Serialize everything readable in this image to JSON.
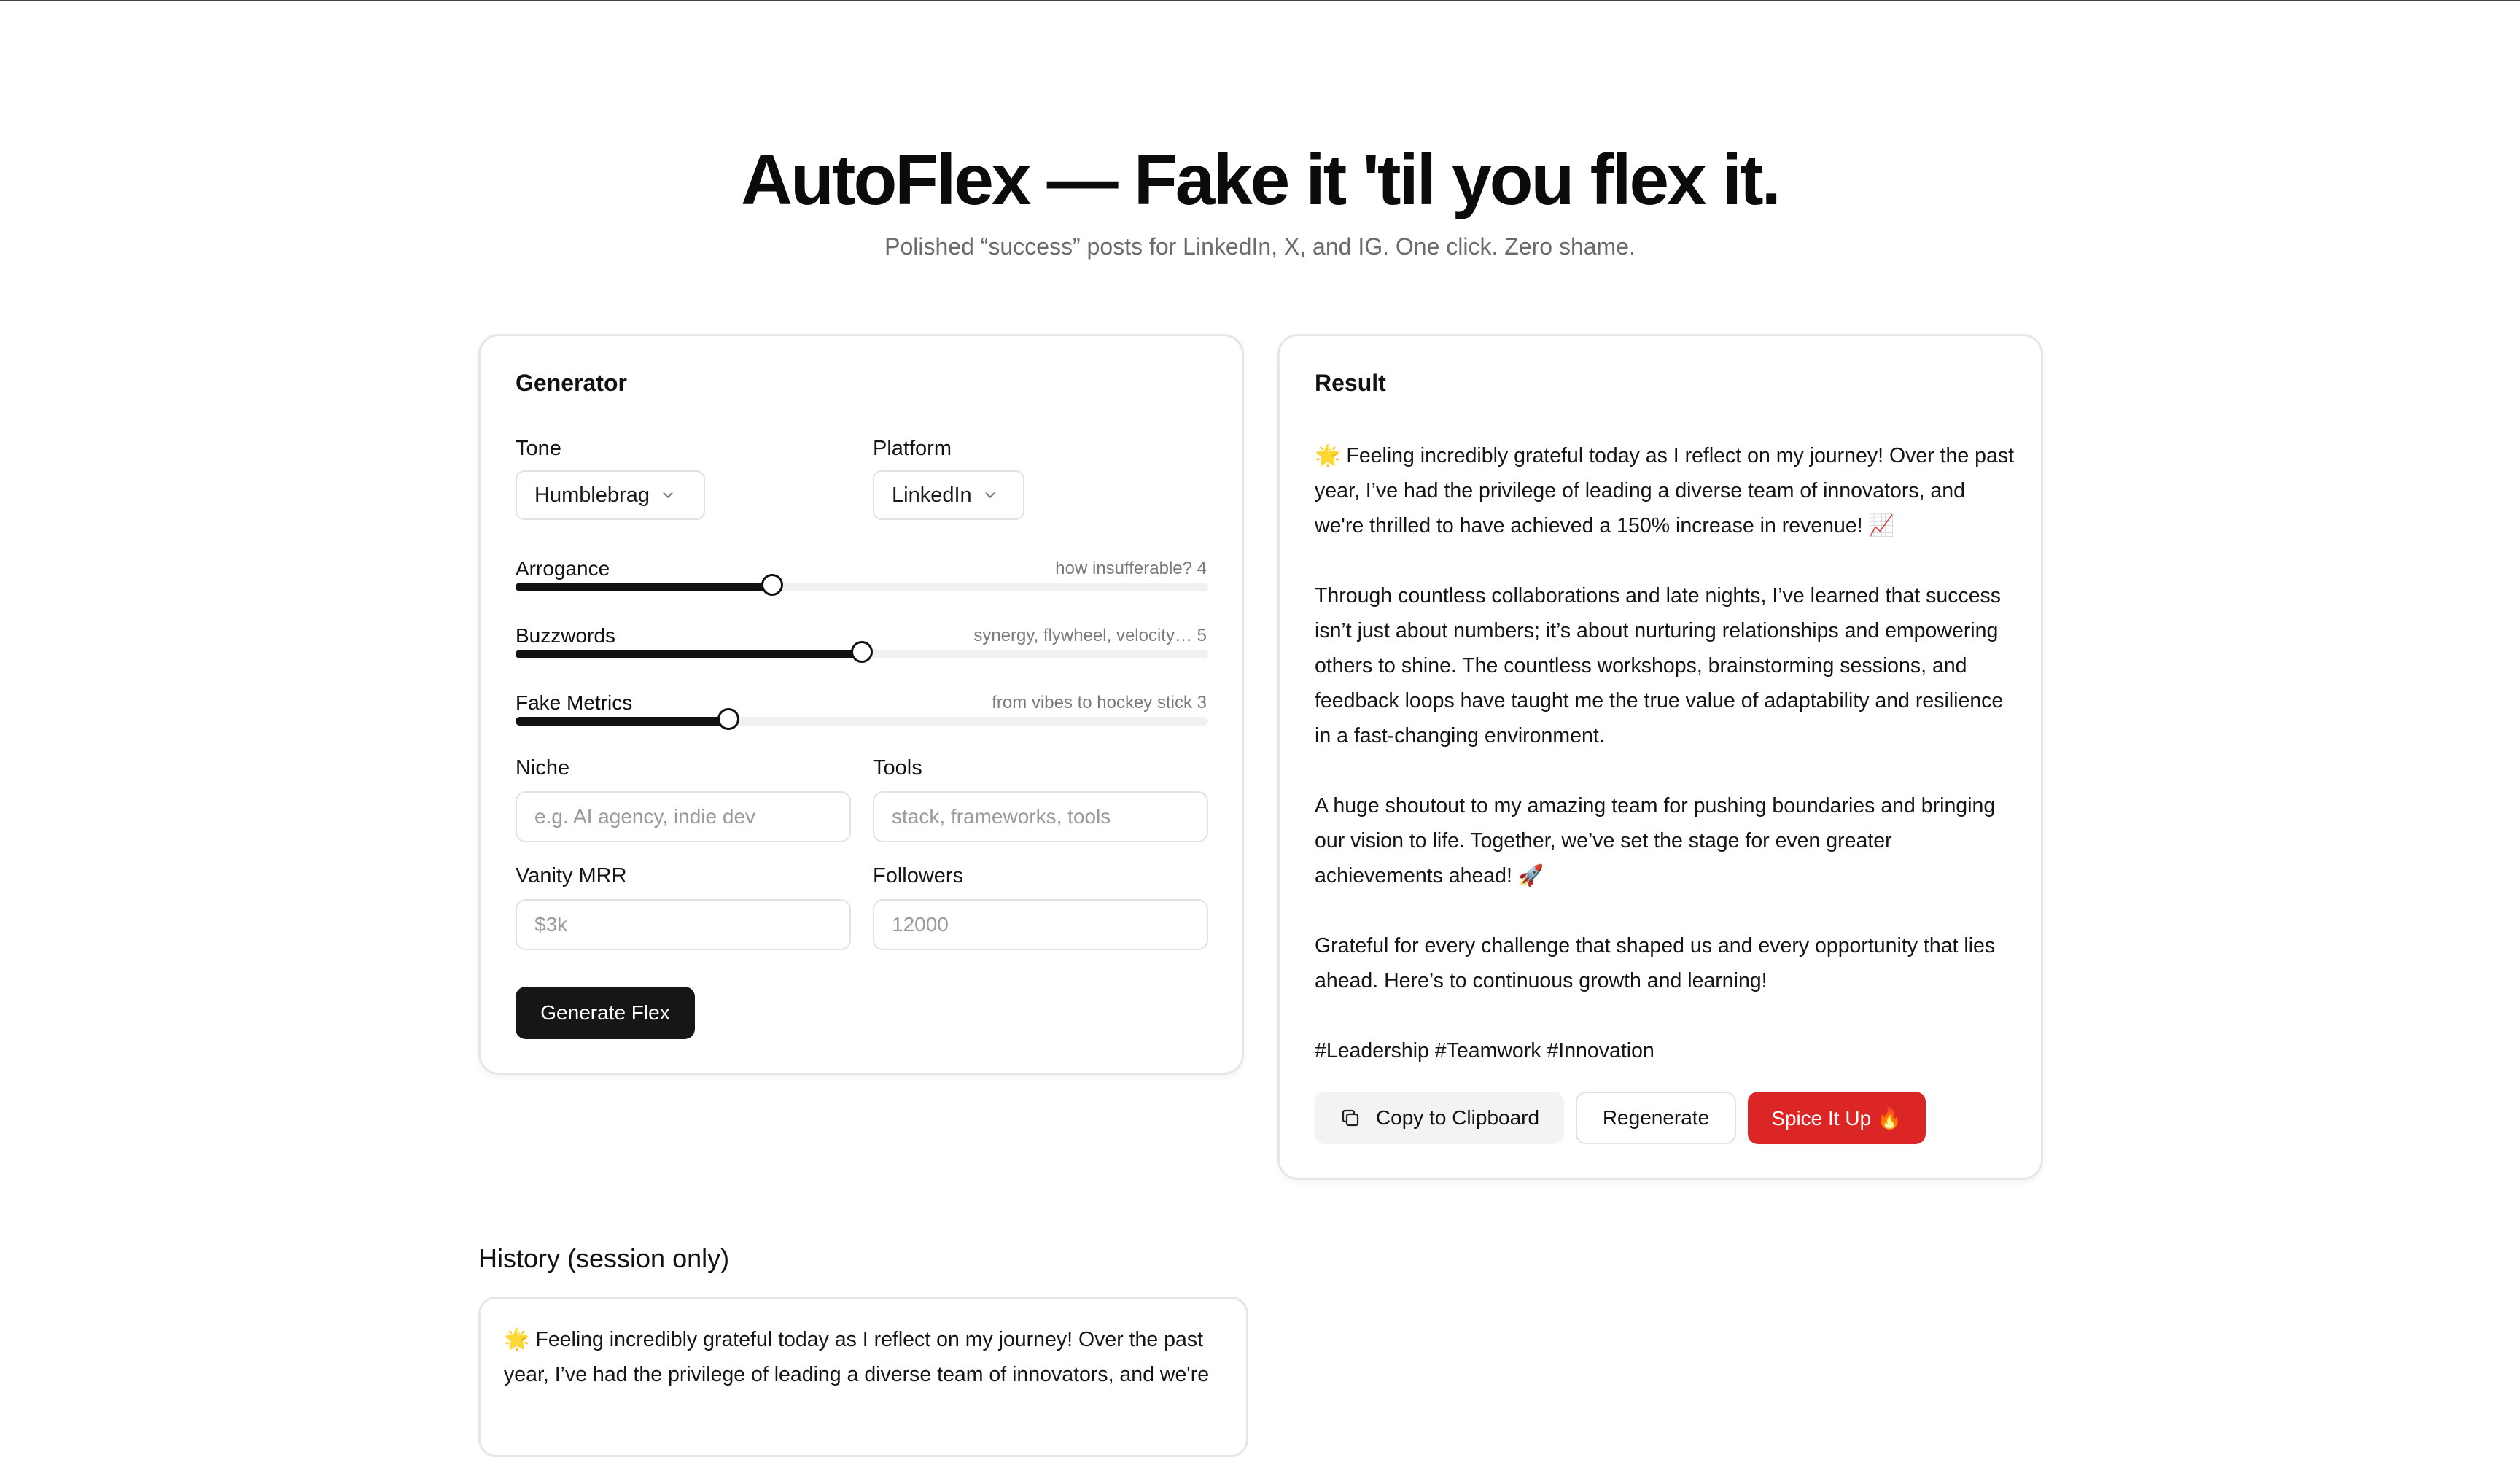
{
  "header": {
    "title": "AutoFlex — Fake it 'til you flex it.",
    "subtitle": "Polished “success” posts for LinkedIn, X, and IG. One click. Zero shame."
  },
  "generator": {
    "title": "Generator",
    "tone": {
      "label": "Tone",
      "value": "Humblebrag"
    },
    "platform": {
      "label": "Platform",
      "value": "LinkedIn"
    },
    "sliders": [
      {
        "label": "Arrogance",
        "hint": "how insufferable? 4",
        "value": 4,
        "fraction": 0.37
      },
      {
        "label": "Buzzwords",
        "hint": "synergy, flywheel, velocity… 5",
        "value": 5,
        "fraction": 0.5
      },
      {
        "label": "Fake Metrics",
        "hint": "from vibes to hockey stick 3",
        "value": 3,
        "fraction": 0.307
      }
    ],
    "niche": {
      "label": "Niche",
      "placeholder": "e.g. AI agency, indie dev",
      "value": ""
    },
    "tools": {
      "label": "Tools",
      "placeholder": "stack, frameworks, tools",
      "value": ""
    },
    "vanity_mrr": {
      "label": "Vanity MRR",
      "placeholder": "$3k",
      "value": ""
    },
    "followers": {
      "label": "Followers",
      "placeholder": "12000",
      "value": ""
    },
    "generate_label": "Generate Flex"
  },
  "result": {
    "title": "Result",
    "paragraphs": [
      "🌟 Feeling incredibly grateful today as I reflect on my journey! Over the past year, I’ve had the privilege of leading a diverse team of innovators, and we're thrilled to have achieved a 150% increase in revenue! 📈",
      "Through countless collaborations and late nights, I’ve learned that success isn’t just about numbers; it’s about nurturing relationships and empowering others to shine. The countless workshops, brainstorming sessions, and feedback loops have taught me the true value of adaptability and resilience in a fast-changing environment.",
      "A huge shoutout to my amazing team for pushing boundaries and bringing our vision to life. Together, we’ve set the stage for even greater achievements ahead! 🚀",
      "Grateful for every challenge that shaped us and every opportunity that lies ahead. Here’s to continuous growth and learning!",
      "#Leadership #Teamwork #Innovation"
    ],
    "copy_label": "Copy to Clipboard",
    "regenerate_label": "Regenerate",
    "spice_label": "Spice It Up 🔥"
  },
  "history": {
    "title": "History (session only)",
    "items": [
      "🌟 Feeling incredibly grateful today as I reflect on my journey! Over the past year, I’ve had the privilege of leading a diverse team of innovators, and we're"
    ]
  },
  "colors": {
    "primary_button": "#161616",
    "spice_button": "#dc2626",
    "card_border": "#e6e6e6"
  },
  "icons": {
    "chevron": "chevron-down-icon",
    "copy": "copy-icon"
  }
}
